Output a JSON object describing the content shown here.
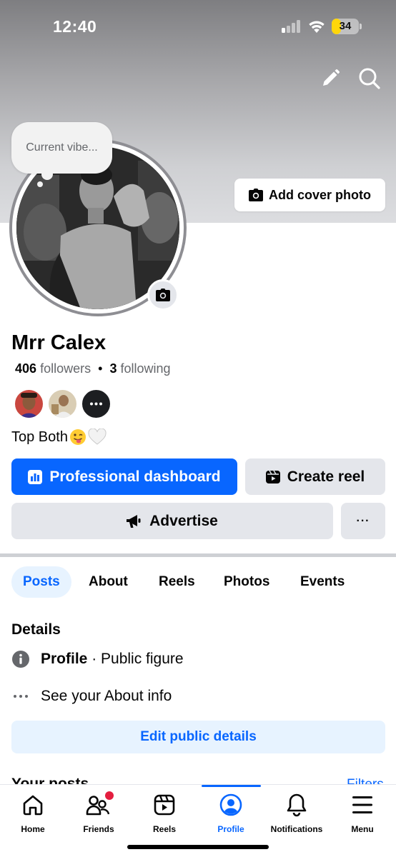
{
  "status_bar": {
    "time": "12:40",
    "battery": "34",
    "battery_percent": 34
  },
  "profile": {
    "thought_bubble": "Current vibe...",
    "add_cover_label": "Add cover photo",
    "name": "Mrr Calex",
    "followers_count": "406",
    "followers_label": "followers",
    "separator": "•",
    "following_count": "3",
    "following_label": "following",
    "bio": "Top Both",
    "bio_emojis": [
      "tongue-face",
      "white-heart"
    ]
  },
  "actions": {
    "professional_dashboard": "Professional dashboard",
    "create_reel": "Create reel",
    "advertise": "Advertise",
    "more": "···"
  },
  "tabs": [
    {
      "label": "Posts",
      "active": true
    },
    {
      "label": "About",
      "active": false
    },
    {
      "label": "Reels",
      "active": false
    },
    {
      "label": "Photos",
      "active": false
    },
    {
      "label": "Events",
      "active": false
    }
  ],
  "details": {
    "title": "Details",
    "category_bold": "Profile",
    "category_rest": " · Public figure",
    "about_info": "See your About info",
    "edit_button": "Edit public details"
  },
  "posts_section": {
    "title": "Your posts",
    "filters": "Filters"
  },
  "bottom_nav": [
    {
      "label": "Home",
      "icon": "home-icon"
    },
    {
      "label": "Friends",
      "icon": "friends-icon",
      "badge": true
    },
    {
      "label": "Reels",
      "icon": "reels-icon"
    },
    {
      "label": "Profile",
      "icon": "profile-icon",
      "active": true
    },
    {
      "label": "Notifications",
      "icon": "bell-icon"
    },
    {
      "label": "Menu",
      "icon": "menu-icon"
    }
  ],
  "colors": {
    "accent": "#0866ff",
    "accent_light": "#e7f3ff",
    "button_grey": "#e4e6eb",
    "badge": "#e41e3f",
    "battery": "#ffd60a"
  }
}
